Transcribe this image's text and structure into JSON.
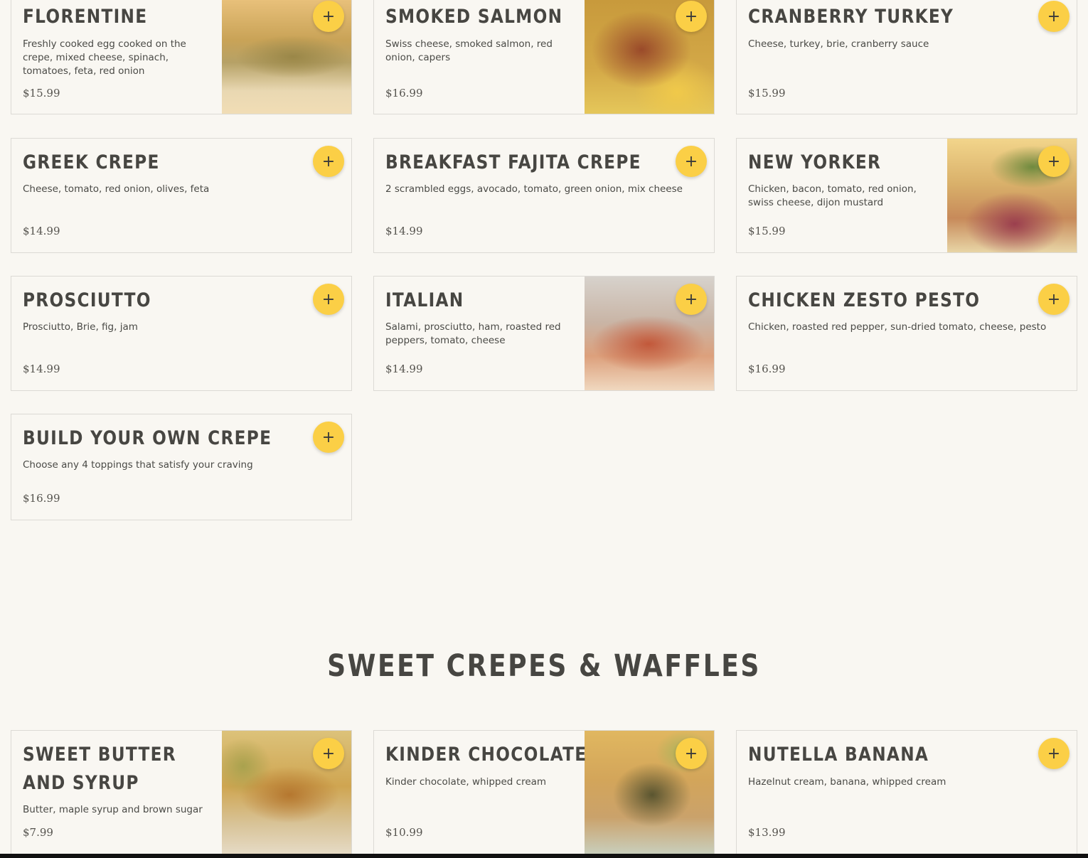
{
  "add_symbol": "+",
  "accent_color": "#fbcf46",
  "savory_items": [
    {
      "name": "Florentine",
      "description": "Freshly cooked egg cooked on the crepe, mixed cheese, spinach, tomatoes, feta, red onion",
      "price": "$15.99",
      "has_image": true
    },
    {
      "name": "Smoked Salmon",
      "description": "Swiss cheese, smoked salmon, red onion, capers",
      "price": "$16.99",
      "has_image": true
    },
    {
      "name": "Cranberry Turkey",
      "description": "Cheese, turkey, brie, cranberry sauce",
      "price": "$15.99",
      "has_image": false
    },
    {
      "name": "Greek Crepe",
      "description": "Cheese, tomato, red onion, olives, feta",
      "price": "$14.99",
      "has_image": false
    },
    {
      "name": "Breakfast Fajita Crepe",
      "description": "2 scrambled eggs, avocado, tomato, green onion, mix cheese",
      "price": "$14.99",
      "has_image": false
    },
    {
      "name": "New Yorker",
      "description": "Chicken, bacon, tomato, red onion, swiss cheese, dijon mustard",
      "price": "$15.99",
      "has_image": true
    },
    {
      "name": "Prosciutto",
      "description": "Prosciutto, Brie, fig, jam",
      "price": "$14.99",
      "has_image": false
    },
    {
      "name": "Italian",
      "description": "Salami, prosciutto, ham, roasted red peppers, tomato, cheese",
      "price": "$14.99",
      "has_image": true
    },
    {
      "name": "Chicken Zesto Pesto",
      "description": "Chicken, roasted red pepper, sun-dried tomato, cheese, pesto",
      "price": "$16.99",
      "has_image": false
    },
    {
      "name": "Build Your Own Crepe",
      "description": "Choose any 4 toppings that satisfy your craving",
      "price": "$16.99",
      "has_image": false
    }
  ],
  "sweet_section": {
    "title": "SWEET CREPES & WAFFLES",
    "items": [
      {
        "name": "Sweet Butter and Syrup",
        "description": "Butter, maple syrup and brown sugar",
        "price": "$7.99",
        "has_image": true
      },
      {
        "name": "Kinder Chocolate",
        "description": "Kinder chocolate, whipped cream",
        "price": "$10.99",
        "has_image": true
      },
      {
        "name": "Nutella Banana",
        "description": "Hazelnut cream, banana, whipped cream",
        "price": "$13.99",
        "has_image": false
      }
    ]
  }
}
